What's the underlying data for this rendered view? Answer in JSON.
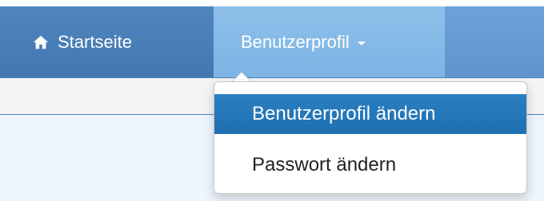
{
  "nav": {
    "home_label": "Startseite",
    "profile_label": "Benutzerprofil"
  },
  "dropdown": {
    "items": [
      {
        "label": "Benutzerprofil ändern",
        "active": true
      },
      {
        "label": "Passwort ändern",
        "active": false
      }
    ]
  },
  "icons": {
    "home": "home-icon",
    "caret": "caret-down-icon"
  },
  "colors": {
    "navbar": "#5d95cc",
    "active_home": "#4377b0",
    "profile_highlight": "#7cb4e4",
    "dropdown_active": "#1f6fb0",
    "content_bg": "#eef6fd"
  }
}
